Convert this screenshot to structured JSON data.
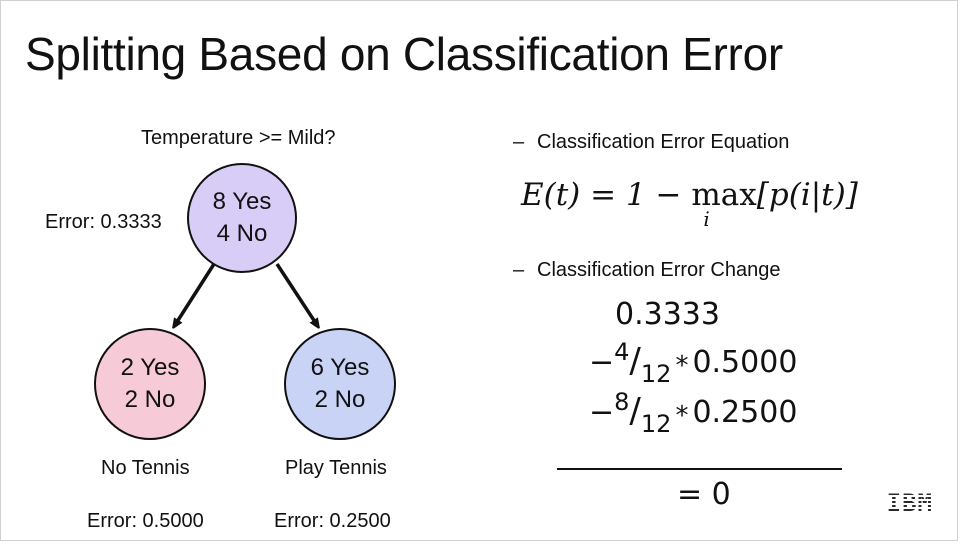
{
  "title": "Splitting Based on Classification Error",
  "tree": {
    "question": "Temperature >= Mild?",
    "root": {
      "line1": "8 Yes",
      "line2": "4 No",
      "error": "Error: 0.3333",
      "color": "#d8cdf6"
    },
    "left": {
      "line1": "2 Yes",
      "line2": "2 No",
      "label": "No Tennis",
      "error": "Error: 0.5000",
      "color": "#f6cad6"
    },
    "right": {
      "line1": "6 Yes",
      "line2": "2 No",
      "label": "Play Tennis",
      "error": "Error: 0.2500",
      "color": "#c9d3f6"
    }
  },
  "panel": {
    "dash": "–",
    "heading1": "Classification Error Equation",
    "heading2": "Classification Error Change",
    "equation": {
      "lhs": "E(t) = 1 − ",
      "op": "max",
      "sub": "i",
      "rhs": "[p(i|t)]"
    },
    "change": {
      "base": "0.3333",
      "term1": {
        "sign": "−",
        "num": "4",
        "den": "12",
        "times": "*",
        "value": "0.5000"
      },
      "term2": {
        "sign": "−",
        "num": "8",
        "den": "12",
        "times": "*",
        "value": "0.2500"
      },
      "result": "= 0"
    }
  },
  "logo": "IBM"
}
